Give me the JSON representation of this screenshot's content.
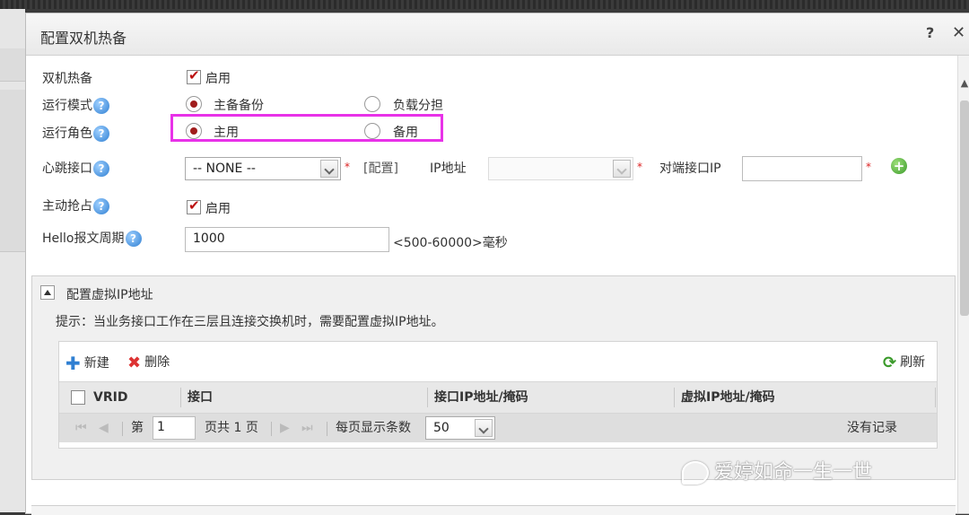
{
  "dialog": {
    "title": "配置双机热备",
    "help_label": "?",
    "close_label": "✕"
  },
  "form": {
    "hot_standby": {
      "label": "双机热备",
      "checked": true,
      "option_label": "启用"
    },
    "run_mode": {
      "label": "运行模式",
      "options": [
        "主备备份",
        "负载分担"
      ],
      "selected": "主备备份"
    },
    "run_role": {
      "label": "运行角色",
      "options": [
        "主用",
        "备用"
      ],
      "selected": "主用"
    },
    "heartbeat": {
      "label": "心跳接口",
      "select_value": "-- NONE --",
      "config_link": "[配置]",
      "ip_label": "IP地址",
      "ip_value": "",
      "peer_ip_label": "对端接口IP",
      "peer_ip_value": ""
    },
    "preempt": {
      "label": "主动抢占",
      "checked": true,
      "option_label": "启用"
    },
    "hello": {
      "label": "Hello报文周期",
      "value": "1000",
      "range_hint": "<500-60000>毫秒"
    },
    "required_mark": "*"
  },
  "vip_section": {
    "title": "配置虚拟IP地址",
    "hint": "提示：当业务接口工作在三层且连接交换机时，需要配置虚拟IP地址。",
    "toolbar": {
      "new_label": "新建",
      "delete_label": "删除",
      "refresh_label": "刷新"
    },
    "columns": [
      "VRID",
      "接口",
      "接口IP地址/掩码",
      "虚拟IP地址/掩码"
    ],
    "pager": {
      "page_prefix": "第",
      "page_value": "1",
      "page_suffix": "页共",
      "total_pages": "1",
      "page_unit": "页",
      "per_page_label": "每页显示条数",
      "per_page_value": "50",
      "empty_text": "没有记录"
    }
  },
  "watermark": {
    "text": "爱婷如命一生一世"
  }
}
